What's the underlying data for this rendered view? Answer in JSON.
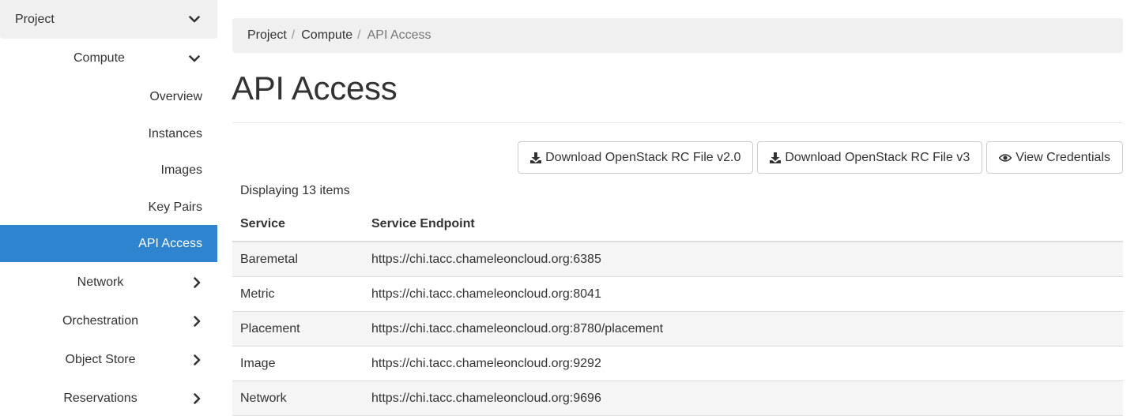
{
  "sidebar": {
    "project": {
      "label": "Project",
      "icon": "chevron-down-icon"
    },
    "compute": {
      "label": "Compute",
      "icon": "chevron-down-icon"
    },
    "compute_items": [
      {
        "label": "Overview"
      },
      {
        "label": "Instances"
      },
      {
        "label": "Images"
      },
      {
        "label": "Key Pairs"
      },
      {
        "label": "API Access",
        "active": true
      }
    ],
    "groups": [
      {
        "label": "Network",
        "icon": "chevron-right-icon"
      },
      {
        "label": "Orchestration",
        "icon": "chevron-right-icon"
      },
      {
        "label": "Object Store",
        "icon": "chevron-right-icon"
      },
      {
        "label": "Reservations",
        "icon": "chevron-right-icon"
      }
    ],
    "active_color": "#2f84d0"
  },
  "breadcrumb": {
    "items": [
      "Project",
      "Compute",
      "API Access"
    ],
    "separator": "/"
  },
  "page": {
    "title": "API Access"
  },
  "actions": {
    "download_v2": {
      "label": "Download OpenStack RC File v2.0",
      "icon": "download-icon"
    },
    "download_v3": {
      "label": "Download OpenStack RC File v3",
      "icon": "download-icon"
    },
    "view_credentials": {
      "label": "View Credentials",
      "icon": "eye-icon"
    }
  },
  "table": {
    "count_text": "Displaying 13 items",
    "headers": {
      "service": "Service",
      "endpoint": "Service Endpoint"
    },
    "rows": [
      {
        "service": "Baremetal",
        "endpoint": "https://chi.tacc.chameleoncloud.org:6385"
      },
      {
        "service": "Metric",
        "endpoint": "https://chi.tacc.chameleoncloud.org:8041"
      },
      {
        "service": "Placement",
        "endpoint": "https://chi.tacc.chameleoncloud.org:8780/placement"
      },
      {
        "service": "Image",
        "endpoint": "https://chi.tacc.chameleoncloud.org:9292"
      },
      {
        "service": "Network",
        "endpoint": "https://chi.tacc.chameleoncloud.org:9696"
      }
    ]
  }
}
